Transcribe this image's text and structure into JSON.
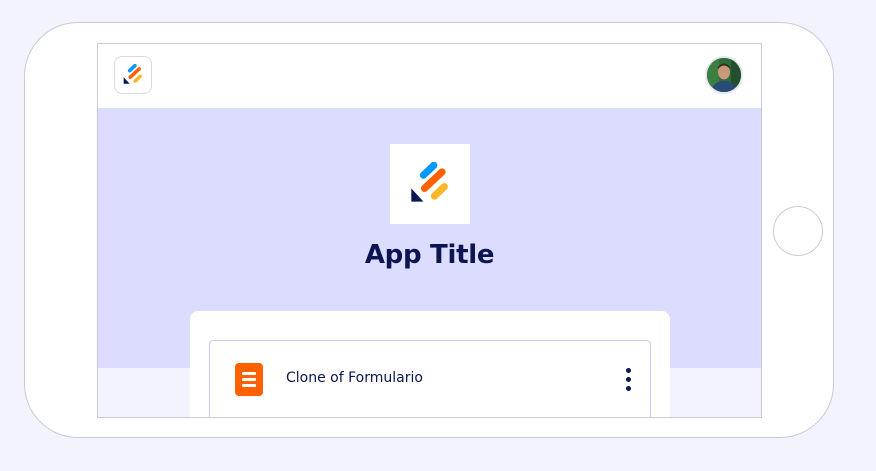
{
  "app": {
    "title": "App Title",
    "logo_icon": "jotform-logo-icon",
    "header_logo_icon": "jotform-logo-icon",
    "avatar_icon": "user-avatar"
  },
  "forms": [
    {
      "name": "Clone of Formulario",
      "icon": "form-document-icon",
      "menu_icon": "more-vertical-icon"
    }
  ],
  "colors": {
    "page_background": "#f3f3fe",
    "hero_background": "#dcdcfe",
    "title_text": "#0a1551",
    "form_icon": "#ff6100",
    "logo_blue": "#0099ff",
    "logo_orange": "#ff6100",
    "logo_yellow": "#ffb629",
    "logo_navy": "#0a1551"
  }
}
